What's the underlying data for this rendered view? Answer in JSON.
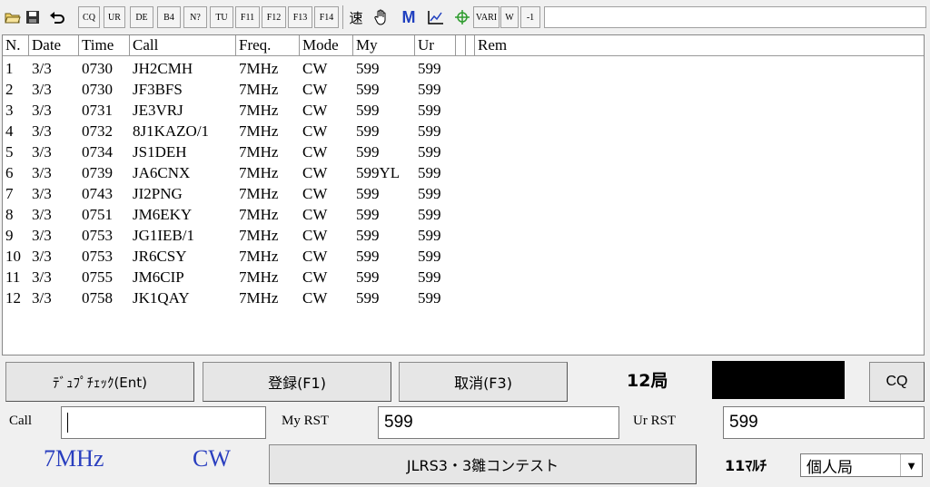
{
  "toolbar": {
    "buttons": [
      "CQ",
      "UR",
      "DE",
      "B4",
      "N?",
      "TU",
      "F11",
      "F12",
      "F13",
      "F14"
    ],
    "speed_label": "速",
    "m_label": "M",
    "vari_label": "VARI",
    "w_label": "W",
    "minus1_label": "-1",
    "icons": [
      "open-folder-icon",
      "save-disk-icon",
      "undo-icon",
      "hand-icon",
      "chart-icon",
      "crosshair-icon"
    ]
  },
  "grid": {
    "headers": [
      "N.",
      "Date",
      "Time",
      "Call",
      "Freq.",
      "Mode",
      "My",
      "Ur",
      "",
      "",
      "Rem"
    ],
    "rows": [
      [
        "1",
        "3/3",
        "0730",
        "JH2CMH",
        "7MHz",
        "CW",
        "599",
        "599"
      ],
      [
        "2",
        "3/3",
        "0730",
        "JF3BFS",
        "7MHz",
        "CW",
        "599",
        "599"
      ],
      [
        "3",
        "3/3",
        "0731",
        "JE3VRJ",
        "7MHz",
        "CW",
        "599",
        "599"
      ],
      [
        "4",
        "3/3",
        "0732",
        "8J1KAZO/1",
        "7MHz",
        "CW",
        "599",
        "599"
      ],
      [
        "5",
        "3/3",
        "0734",
        "JS1DEH",
        "7MHz",
        "CW",
        "599",
        "599"
      ],
      [
        "6",
        "3/3",
        "0739",
        "JA6CNX",
        "7MHz",
        "CW",
        "599YL",
        "599"
      ],
      [
        "7",
        "3/3",
        "0743",
        "JI2PNG",
        "7MHz",
        "CW",
        "599",
        "599"
      ],
      [
        "8",
        "3/3",
        "0751",
        "JM6EKY",
        "7MHz",
        "CW",
        "599",
        "599"
      ],
      [
        "9",
        "3/3",
        "0753",
        "JG1IEB/1",
        "7MHz",
        "CW",
        "599",
        "599"
      ],
      [
        "10",
        "3/3",
        "0753",
        "JR6CSY",
        "7MHz",
        "CW",
        "599",
        "599"
      ],
      [
        "11",
        "3/3",
        "0755",
        "JM6CIP",
        "7MHz",
        "CW",
        "599",
        "599"
      ],
      [
        "12",
        "3/3",
        "0758",
        "JK1QAY",
        "7MHz",
        "CW",
        "599",
        "599"
      ]
    ]
  },
  "actions": {
    "dupe_check": "ﾃﾞｭﾌﾟﾁｪｯｸ(Ent)",
    "register": "登録(F1)",
    "cancel": "取消(F3)",
    "station_count": "12局",
    "cq": "CQ"
  },
  "entry": {
    "call_label": "Call",
    "call_value": "",
    "my_rst_label": "My RST",
    "my_rst_value": "599",
    "ur_rst_label": "Ur RST",
    "ur_rst_value": "599"
  },
  "status": {
    "band": "7MHz",
    "mode": "CW",
    "contest_name": "JLRS3・3雛コンテスト",
    "multi_count": "11ﾏﾙﾁ",
    "category_selected": "個人局"
  }
}
